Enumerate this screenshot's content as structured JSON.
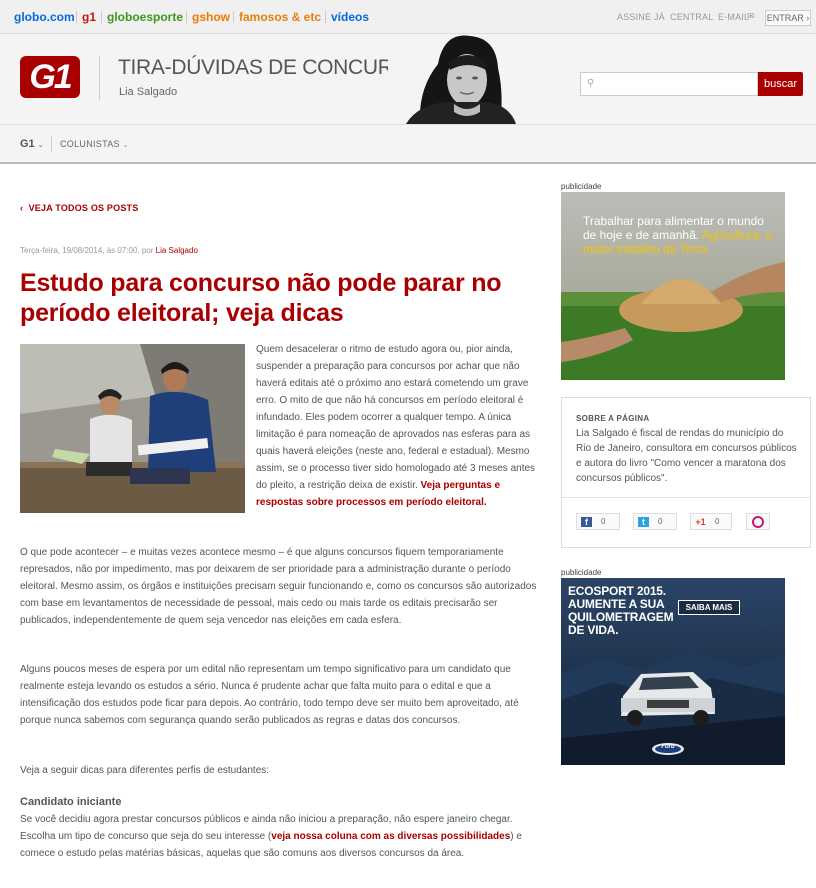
{
  "topbar": {
    "links": [
      {
        "label": "globo.com",
        "color": "#0669de"
      },
      {
        "label": "g1",
        "color": "#c4170c"
      },
      {
        "label": "globoesporte",
        "color": "#3a9a1a"
      },
      {
        "label": "gshow",
        "color": "#f07800"
      },
      {
        "label": "famosos & etc",
        "color": "#e5800a"
      },
      {
        "label": "vídeos",
        "color": "#0669de"
      }
    ],
    "utility": [
      "ASSINE JÁ",
      "CENTRAL",
      "E-MAIL"
    ],
    "enter": "ENTRAR"
  },
  "header": {
    "logo": "G1",
    "title": "TIRA-DÚVIDAS DE CONCURSOS",
    "author": "Lia Salgado",
    "search_button": "buscar"
  },
  "nav": {
    "g1": "G1",
    "columnists": "COLUNISTAS"
  },
  "article": {
    "back": "VEJA TODOS OS POSTS",
    "meta_date": "Terça-feira, 19/08/2014, às 07:00, por ",
    "meta_author": "Lia Salgado",
    "headline": "Estudo para concurso não pode parar no período eleitoral; veja dicas",
    "p1": "Quem desacelerar o ritmo de estudo agora ou, pior ainda, suspender a preparação para concursos por achar que não haverá editais até o próximo ano estará cometendo um grave erro. O mito de que não há concursos em período eleitoral é infundado. Eles podem ocorrer a qualquer tempo. A única limitação é para nomeação de aprovados nas esferas para as quais haverá eleições (neste ano, federal e estadual). Mesmo assim, se o processo tiver sido homologado até 3 meses antes do pleito, a restrição deixa de existir. ",
    "p1_link": "Veja perguntas e respostas sobre processos em período eleitoral.",
    "p2": "O que pode acontecer – e muitas vezes acontece mesmo – é que alguns concursos fiquem temporariamente represados, não por impedimento, mas por deixarem de ser prioridade para a administração durante o período eleitoral. Mesmo assim, os órgãos e instituições precisam seguir funcionando e, como os concursos são autorizados com base em levantamentos de necessidade de pessoal, mais cedo ou mais tarde os editais precisarão ser publicados, independentemente de quem seja vencedor nas eleições em cada esfera.",
    "p3": "Alguns poucos meses de espera por um edital não representam um tempo significativo para um candidato que realmente esteja levando os estudos a sério. Nunca é prudente achar que falta muito para o edital e que a intensificação dos estudos pode ficar para depois. Ao contrário, todo tempo deve ser muito bem aproveitado, até porque nunca sabemos com segurança quando serão publicados as regras e datas dos concursos.",
    "p4": "Veja a seguir dicas para diferentes perfis de estudantes:",
    "subhead": "Candidato iniciante",
    "p5_a": "Se você decidiu agora prestar concursos públicos e ainda não iniciou a preparação, não espere janeiro chegar. Escolha um tipo de concurso que seja do seu interesse (",
    "p5_link": "veja nossa coluna com as diversas possibilidades",
    "p5_b": ") e comece o estudo pelas matérias básicas, aquelas que são comuns aos diversos concursos da área."
  },
  "sidebar": {
    "ad_label": "publicidade",
    "ad1_line1": "Trabalhar para alimentar o mundo de hoje e de amanhã.",
    "ad1_line2": "Agricultura, o maior trabalho da Terra.",
    "about_heading": "SOBRE A PÁGINA",
    "about_text": "Lia Salgado é fiscal de rendas do município do Rio de Janeiro, consultora em concursos públicos e autora do livro \"Como vencer a maratona dos concursos públicos\".",
    "shares": [
      {
        "icon": "f",
        "count": "0",
        "color": "#3b5998"
      },
      {
        "icon": "t",
        "count": "0",
        "color": "#2aa3e0"
      },
      {
        "icon": "+1",
        "count": "0",
        "color": "#d73d32"
      }
    ],
    "ad2_text": "ECOSPORT 2015. AUMENTE A SUA QUILOMETRAGEM DE VIDA.",
    "ad2_button": "SAIBA MAIS",
    "ad2_brand": "Ford"
  }
}
